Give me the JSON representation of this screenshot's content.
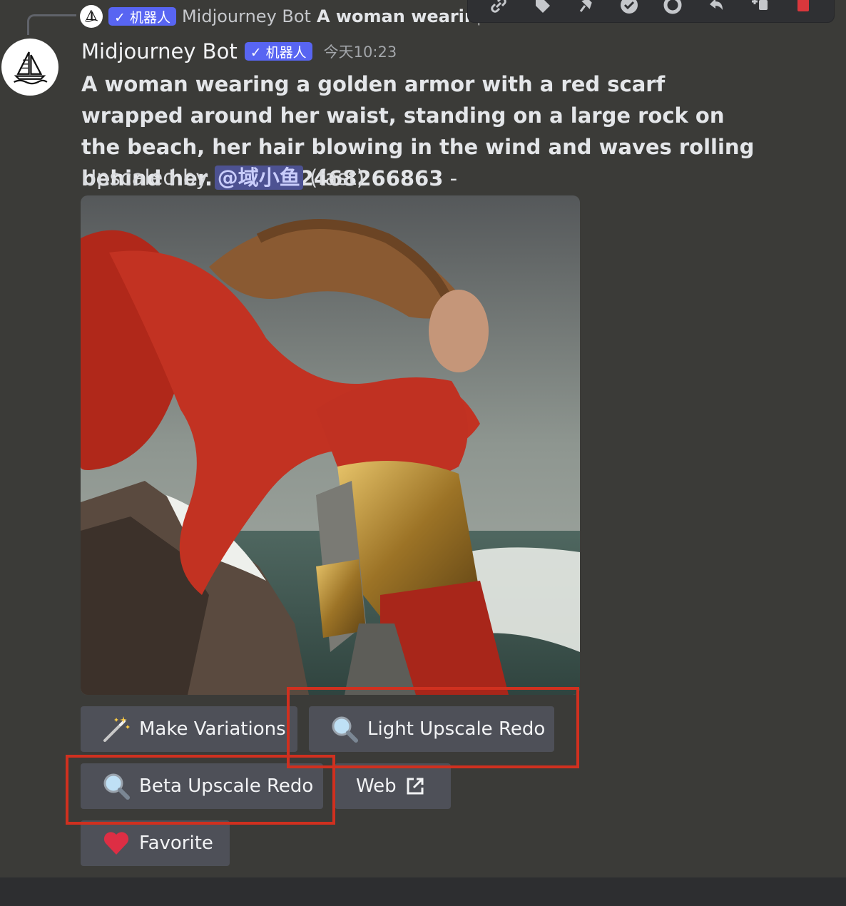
{
  "reply": {
    "author": "Midjourney Bot",
    "badge": "✓ 机器人",
    "preview_bold": "A woman wearing a golden armor with a red scarf"
  },
  "toolbar": {
    "icons": [
      "link-icon",
      "tag-icon",
      "pin-icon",
      "check-icon",
      "refresh-icon",
      "reply-icon",
      "add-thread-icon",
      "delete-icon"
    ],
    "delete_color": "#da373c"
  },
  "message": {
    "author": "Midjourney Bot",
    "badge": "✓ 机器人",
    "timestamp": "今天10:23",
    "prompt": "A woman wearing a golden armor with a red scarf wrapped around her waist, standing on a large rock on the beach, her hair blowing in the wind and waves rolling behind her. --seed 2468266863",
    "dash": " -",
    "upscaled_prefix": "Upscaled by ",
    "mention": "@域小鱼",
    "upscaled_suffix": " (fast)"
  },
  "buttons": {
    "make_variations": "Make Variations",
    "light_upscale_redo": "Light Upscale Redo",
    "beta_upscale_redo": "Beta Upscale Redo",
    "web": "Web",
    "favorite": "Favorite"
  },
  "colors": {
    "background": "#3b3b38",
    "button": "#4e5058",
    "badge": "#5865f2",
    "highlight": "#d0301f",
    "mention_bg": "#4d5292"
  }
}
